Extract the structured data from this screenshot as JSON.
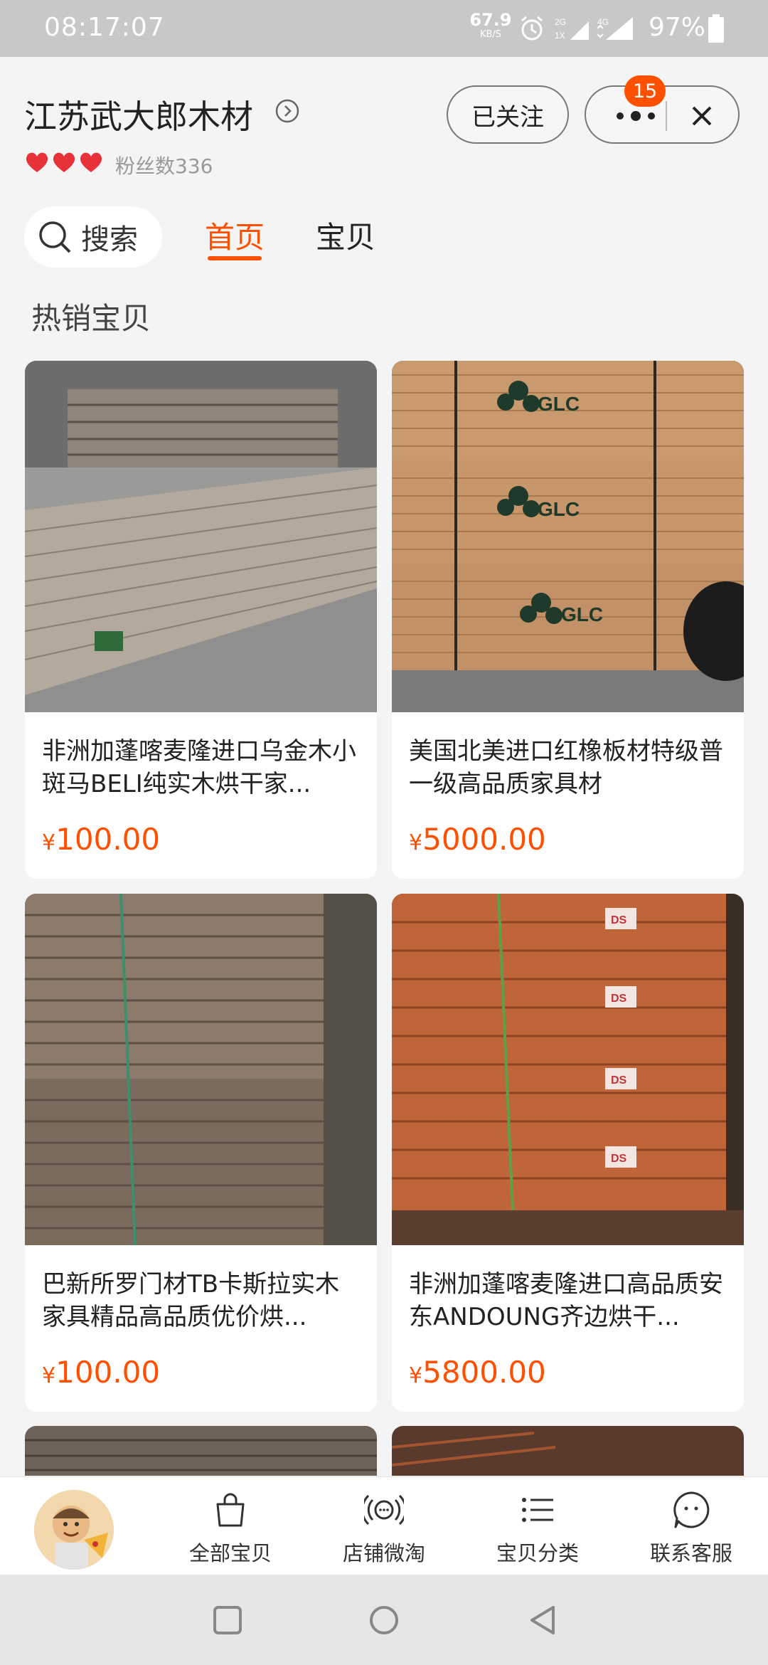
{
  "status_bar": {
    "time": "08:17:07",
    "speed_value": "67.9",
    "speed_unit": "KB/S",
    "battery": "97%"
  },
  "header": {
    "shop_name": "江苏武大郎木材",
    "fans": "粉丝数336",
    "follow_label": "已关注",
    "badge_count": "15"
  },
  "tabs": {
    "search_label": "搜索",
    "home": "首页",
    "items": "宝贝"
  },
  "section_title": "热销宝贝",
  "products": [
    {
      "title": "非洲加蓬喀麦隆进口乌金木小斑马BELI纯实木烘干家...",
      "currency": "¥",
      "price": "100.00"
    },
    {
      "title": "美国北美进口红橡板材特级普一级高品质家具材",
      "currency": "¥",
      "price": "5000.00"
    },
    {
      "title": "巴新所罗门材TB卡斯拉实木家具精品高品质优价烘...",
      "currency": "¥",
      "price": "100.00"
    },
    {
      "title": "非洲加蓬喀麦隆进口高品质安东ANDOUNG齐边烘干...",
      "currency": "¥",
      "price": "5800.00"
    }
  ],
  "image_labels": {
    "glc": "GLC",
    "ds": "DS"
  },
  "bottom_nav": {
    "all_items": "全部宝贝",
    "micro_shop": "店铺微淘",
    "category": "宝贝分类",
    "service": "联系客服"
  },
  "colors": {
    "accent": "#ff5000",
    "heart": "#e8323a",
    "status_bar": "#c8c8c8"
  }
}
